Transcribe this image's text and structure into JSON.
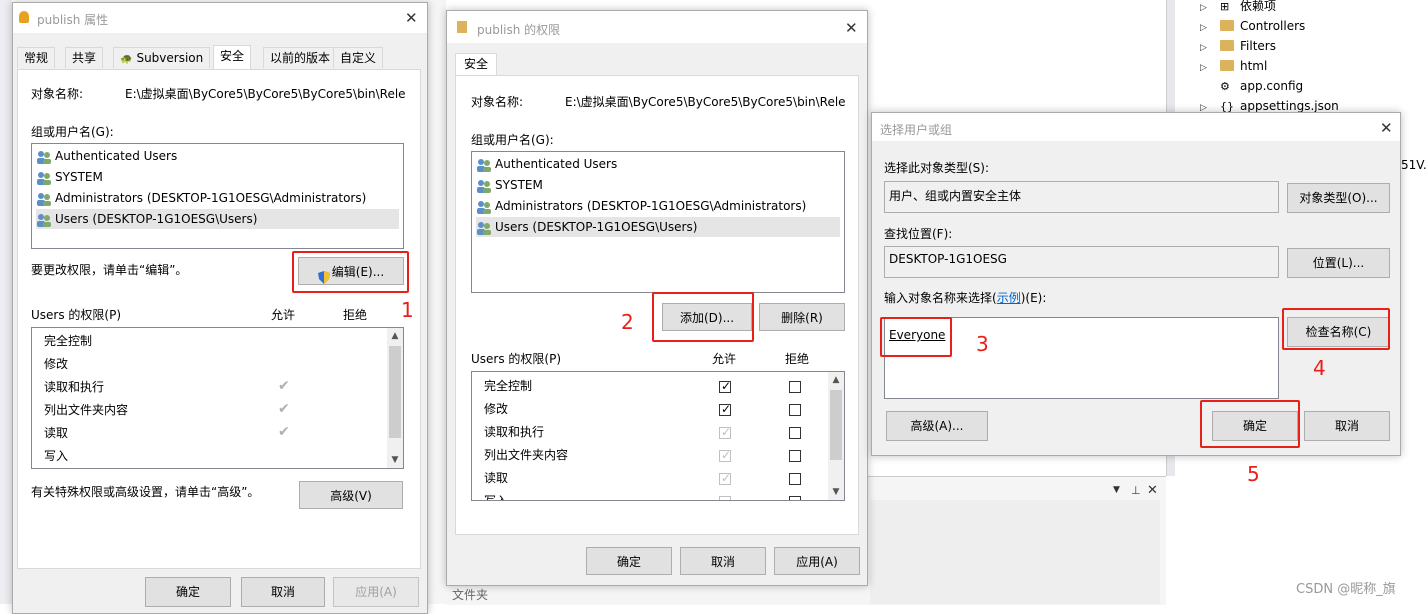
{
  "background": {
    "tree_items": [
      "依赖项",
      "Controllers",
      "Filters",
      "html",
      "app.config",
      "appsettings.json"
    ],
    "partial_text_right": "51V.",
    "bottom_folder_label": "文件夹",
    "watermark": "CSDN @昵称_旗"
  },
  "props_dialog": {
    "title": "publish 属性",
    "tabs": [
      "常规",
      "共享",
      "Subversion",
      "安全",
      "以前的版本",
      "自定义"
    ],
    "object_label": "对象名称:",
    "object_value": "E:\\虚拟桌面\\ByCore5\\ByCore5\\ByCore5\\bin\\Rele",
    "group_label": "组或用户名(G):",
    "users": [
      "Authenticated Users",
      "SYSTEM",
      "Administrators (DESKTOP-1G1OESG\\Administrators)",
      "Users (DESKTOP-1G1OESG\\Users)"
    ],
    "change_hint": "要更改权限，请单击“编辑”。",
    "edit_button": "编辑(E)...",
    "perms_label": "Users 的权限(P)",
    "allow_header": "允许",
    "deny_header": "拒绝",
    "perms": [
      "完全控制",
      "修改",
      "读取和执行",
      "列出文件夹内容",
      "读取",
      "写入"
    ],
    "special_hint": "有关特殊权限或高级设置，请单击“高级”。",
    "advanced_button": "高级(V)",
    "ok": "确定",
    "cancel": "取消",
    "apply": "应用(A)"
  },
  "perm_dialog": {
    "title": "publish 的权限",
    "tab": "安全",
    "object_label": "对象名称:",
    "object_value": "E:\\虚拟桌面\\ByCore5\\ByCore5\\ByCore5\\bin\\Rele",
    "group_label": "组或用户名(G):",
    "users": [
      "Authenticated Users",
      "SYSTEM",
      "Administrators (DESKTOP-1G1OESG\\Administrators)",
      "Users (DESKTOP-1G1OESG\\Users)"
    ],
    "add_button": "添加(D)...",
    "remove_button": "删除(R)",
    "perms_label": "Users 的权限(P)",
    "allow_header": "允许",
    "deny_header": "拒绝",
    "perms": [
      "完全控制",
      "修改",
      "读取和执行",
      "列出文件夹内容",
      "读取",
      "写入"
    ],
    "ok": "确定",
    "cancel": "取消",
    "apply": "应用(A)"
  },
  "select_dialog": {
    "title": "选择用户或组",
    "type_label": "选择此对象类型(S):",
    "type_value": "用户、组或内置安全主体",
    "type_button": "对象类型(O)...",
    "location_label": "查找位置(F):",
    "location_value": "DESKTOP-1G1OESG",
    "location_button": "位置(L)...",
    "enter_label_pre": "输入对象名称来选择(",
    "enter_label_link": "示例",
    "enter_label_post": ")(E):",
    "entered_name": "Everyone",
    "check_button": "检查名称(C)",
    "advanced_button": "高级(A)...",
    "ok": "确定",
    "cancel": "取消"
  },
  "annotations": [
    "1",
    "2",
    "3",
    "4",
    "5"
  ],
  "colors": {
    "annotation_red": "#e8201a",
    "dialog_bg": "#f0f0f0",
    "link_blue": "#0066cc"
  }
}
